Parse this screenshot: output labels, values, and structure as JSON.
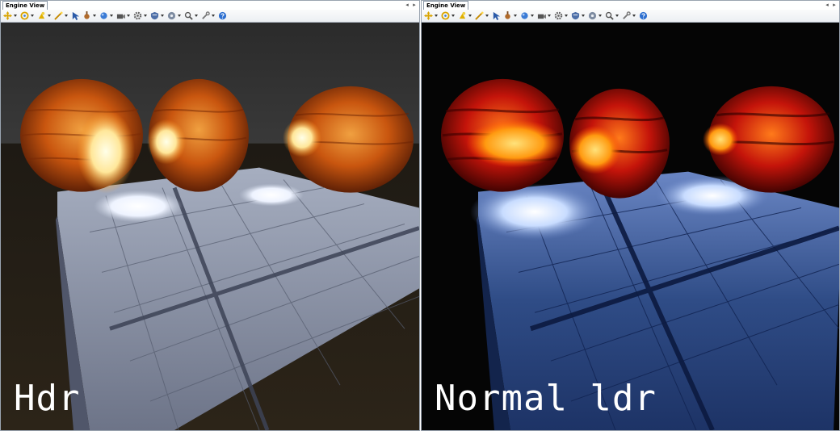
{
  "panes": [
    {
      "tab_title": "Engine View",
      "caption": "Hdr",
      "toolbar": [
        "move-icon",
        "rotate-icon",
        "lightbulb-icon",
        "wand-icon",
        "cursor-icon",
        "gear-paint-icon",
        "sphere-icon",
        "camera-icon",
        "settings-icon",
        "shield-icon",
        "disc-icon",
        "magnifier-icon",
        "wrench-icon",
        "help-icon"
      ]
    },
    {
      "tab_title": "Engine View",
      "caption": "Normal ldr",
      "toolbar": [
        "move-icon",
        "rotate-icon",
        "lightbulb-icon",
        "wand-icon",
        "cursor-icon",
        "gear-paint-icon",
        "sphere-icon",
        "camera-icon",
        "settings-icon",
        "shield-icon",
        "disc-icon",
        "magnifier-icon",
        "wrench-icon",
        "help-icon"
      ]
    }
  ],
  "colors": {
    "hdr_sky": "#2b2b2b",
    "hdr_floor": "#8c93a6",
    "ldr_sky": "#050505",
    "ldr_floor": "#2f4c86",
    "sphere_orange": "#c9560f",
    "ldr_sphere_red": "#c4140a"
  }
}
